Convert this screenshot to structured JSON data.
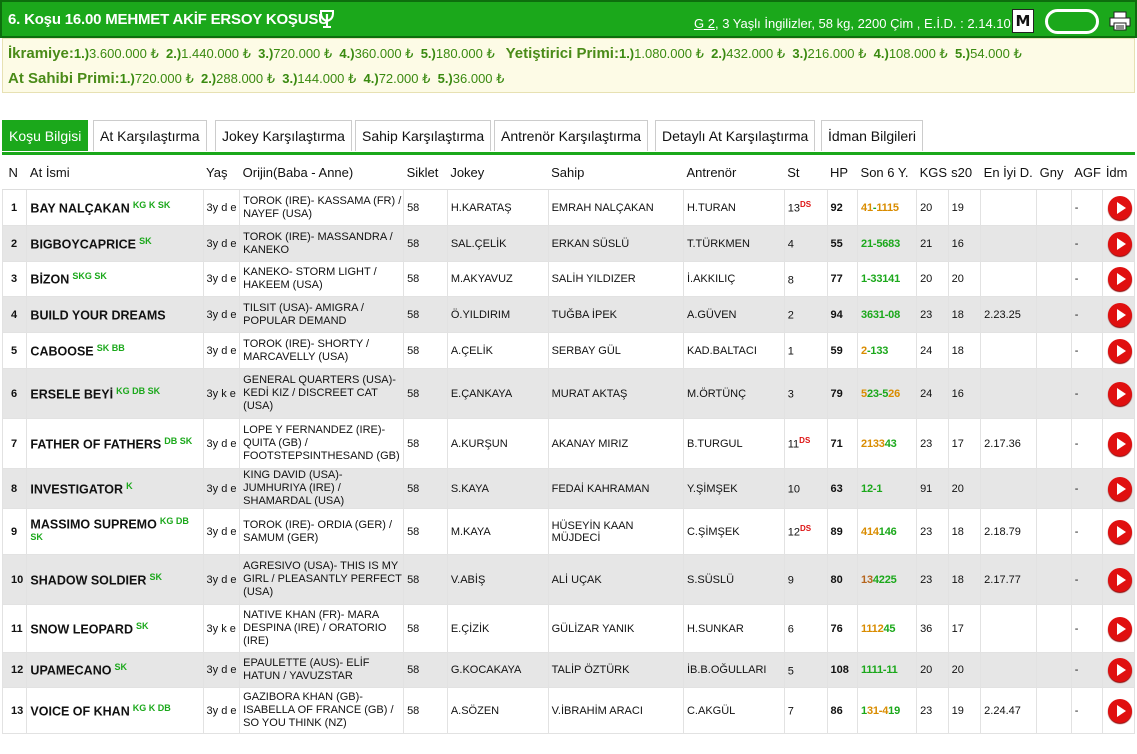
{
  "header": {
    "title": "6. Koşu 16.00 MEHMET AKİF ERSOY KOŞUSU",
    "group": "G 2",
    "info_rest": ", 3 Yaşlı İngilizler, 58 kg, 2200 Çim , E.İ.D. : 2.14.10",
    "m_label": "M"
  },
  "prize": {
    "ikramiye_label": "İkramiye:",
    "ikramiye": [
      {
        "pos": "1.)",
        "amt": "3.600.000 ₺"
      },
      {
        "pos": "2.)",
        "amt": "1.440.000 ₺"
      },
      {
        "pos": "3.)",
        "amt": "720.000 ₺"
      },
      {
        "pos": "4.)",
        "amt": "360.000 ₺"
      },
      {
        "pos": "5.)",
        "amt": "180.000 ₺"
      }
    ],
    "yetistirici_label": "Yetiştirici Primi:",
    "yetistirici": [
      {
        "pos": "1.)",
        "amt": "1.080.000 ₺"
      },
      {
        "pos": "2.)",
        "amt": "432.000 ₺"
      },
      {
        "pos": "3.)",
        "amt": "216.000 ₺"
      },
      {
        "pos": "4.)",
        "amt": "108.000 ₺"
      },
      {
        "pos": "5.)",
        "amt": "54.000 ₺"
      }
    ],
    "atsahibi_label": "At Sahibi Primi:",
    "atsahibi": [
      {
        "pos": "1.)",
        "amt": "720.000 ₺"
      },
      {
        "pos": "2.)",
        "amt": "288.000 ₺"
      },
      {
        "pos": "3.)",
        "amt": "144.000 ₺"
      },
      {
        "pos": "4.)",
        "amt": "72.000 ₺"
      },
      {
        "pos": "5.)",
        "amt": "36.000 ₺"
      }
    ]
  },
  "tabs": [
    {
      "label": "Koşu Bilgisi",
      "active": true
    },
    {
      "label": "At Karşılaştırma"
    },
    {
      "label": "Jokey Karşılaştırma"
    },
    {
      "label": "Sahip Karşılaştırma"
    },
    {
      "label": "Antrenör Karşılaştırma"
    },
    {
      "label": "Detaylı At Karşılaştırma"
    },
    {
      "label": "İdman Bilgileri"
    }
  ],
  "columns": [
    "N",
    "At İsmi",
    "Yaş",
    "Orijin(Baba - Anne)",
    "Siklet",
    "Jokey",
    "Sahip",
    "Antrenör",
    "St",
    "HP",
    "Son 6 Y.",
    "KGS",
    "s20",
    "En İyi D.",
    "Gny",
    "AGF",
    "İdm"
  ],
  "colors": {
    "green": "#1ba81b",
    "orange": "#d98c00",
    "brown": "#b5651d",
    "red": "#d11111"
  },
  "rows": [
    {
      "n": "1",
      "name": "BAY NALÇAKAN",
      "badges": "KG K SK",
      "age": "3y d e",
      "origin": "TOROK (IRE)- KASSAMA (FR) / NAYEF (USA)",
      "weight": "58",
      "jockey": "H.KARATAŞ",
      "owner": "EMRAH NALÇAKAN",
      "trainer": "H.TURAN",
      "st": "13",
      "st_sup": "DS",
      "hp": "92",
      "last6": [
        [
          "41",
          "o"
        ],
        [
          "-",
          "g"
        ],
        [
          "1115",
          "o"
        ]
      ],
      "kgs": "20",
      "s20": "19",
      "best": "",
      "gny": "",
      "agf": "-"
    },
    {
      "n": "2",
      "name": "BIGBOYCAPRICE",
      "badges": "SK",
      "age": "3y d e",
      "origin": "TOROK (IRE)- MASSANDRA / KANEKO",
      "weight": "58",
      "jockey": "SAL.ÇELİK",
      "owner": "ERKAN SÜSLÜ",
      "trainer": "T.TÜRKMEN",
      "st": "4",
      "st_sup": "",
      "hp": "55",
      "last6": [
        [
          "21-5683",
          "g"
        ]
      ],
      "kgs": "21",
      "s20": "16",
      "best": "",
      "gny": "",
      "agf": "-"
    },
    {
      "n": "3",
      "name": "BİZON",
      "badges": "SKG SK",
      "age": "3y d e",
      "origin": "KANEKO- STORM LIGHT / HAKEEM (USA)",
      "weight": "58",
      "jockey": "M.AKYAVUZ",
      "owner": "SALİH YILDIZER",
      "trainer": "İ.AKKILIÇ",
      "st": "8",
      "st_sup": "",
      "hp": "77",
      "last6": [
        [
          "1-33141",
          "g"
        ]
      ],
      "kgs": "20",
      "s20": "20",
      "best": "",
      "gny": "",
      "agf": "-"
    },
    {
      "n": "4",
      "name": "BUILD YOUR DREAMS",
      "badges": "",
      "age": "3y d e",
      "origin": "TILSIT (USA)- AMIGRA / POPULAR DEMAND",
      "weight": "58",
      "jockey": "Ö.YILDIRIM",
      "owner": "TUĞBA İPEK",
      "trainer": "A.GÜVEN",
      "st": "2",
      "st_sup": "",
      "hp": "94",
      "last6": [
        [
          "3631-08",
          "g"
        ]
      ],
      "kgs": "23",
      "s20": "18",
      "best": "2.23.25",
      "gny": "",
      "agf": "-"
    },
    {
      "n": "5",
      "name": "CABOOSE",
      "badges": "SK BB",
      "age": "3y d e",
      "origin": "TOROK (IRE)- SHORTY / MARCAVELLY (USA)",
      "weight": "58",
      "jockey": "A.ÇELİK",
      "owner": "SERBAY GÜL",
      "trainer": "KAD.BALTACI",
      "st": "1",
      "st_sup": "",
      "hp": "59",
      "last6": [
        [
          "2",
          "o"
        ],
        [
          "-133",
          "g"
        ]
      ],
      "kgs": "24",
      "s20": "18",
      "best": "",
      "gny": "",
      "agf": "-"
    },
    {
      "n": "6",
      "name": "ERSELE BEYİ",
      "badges": "KG DB SK",
      "age": "3y k e",
      "origin": "GENERAL QUARTERS (USA)- KEDİ KIZ / DISCREET CAT (USA)",
      "weight": "58",
      "jockey": "E.ÇANKAYA",
      "owner": "MURAT AKTAŞ",
      "trainer": "M.ÖRTÜNÇ",
      "st": "3",
      "st_sup": "",
      "hp": "79",
      "last6": [
        [
          "5",
          "o"
        ],
        [
          "23-5",
          "g"
        ],
        [
          "26",
          "o"
        ]
      ],
      "kgs": "24",
      "s20": "16",
      "best": "",
      "gny": "",
      "agf": "-"
    },
    {
      "n": "7",
      "name": "FATHER OF FATHERS",
      "badges": "DB SK",
      "age": "3y d e",
      "origin": "LOPE Y FERNANDEZ (IRE)- QUITA (GB) / FOOTSTEPSINTHESAND (GB)",
      "weight": "58",
      "jockey": "A.KURŞUN",
      "owner": "AKANAY MIRIZ",
      "trainer": "B.TURGUL",
      "st": "11",
      "st_sup": "DS",
      "hp": "71",
      "last6": [
        [
          "2133",
          "o"
        ],
        [
          "43",
          "g"
        ]
      ],
      "kgs": "23",
      "s20": "17",
      "best": "2.17.36",
      "gny": "",
      "agf": "-"
    },
    {
      "n": "8",
      "name": "INVESTIGATOR",
      "badges": "K",
      "age": "3y d e",
      "origin": "KING DAVID (USA)- JUMHURIYA (IRE) / SHAMARDAL (USA)",
      "weight": "58",
      "jockey": "S.KAYA",
      "owner": "FEDAİ KAHRAMAN",
      "trainer": "Y.ŞİMŞEK",
      "st": "10",
      "st_sup": "",
      "hp": "63",
      "last6": [
        [
          "12-1",
          "g"
        ]
      ],
      "kgs": "91",
      "s20": "20",
      "best": "",
      "gny": "",
      "agf": "-"
    },
    {
      "n": "9",
      "name": "MASSIMO SUPREMO",
      "badges": "KG DB SK",
      "age": "3y d e",
      "origin": "TOROK (IRE)- ORDIA (GER) / SAMUM (GER)",
      "weight": "58",
      "jockey": "M.KAYA",
      "owner": "HÜSEYİN KAAN MÜJDECİ",
      "trainer": "C.ŞİMŞEK",
      "st": "12",
      "st_sup": "DS",
      "hp": "89",
      "last6": [
        [
          "414",
          "o"
        ],
        [
          "146",
          "g"
        ]
      ],
      "kgs": "23",
      "s20": "18",
      "best": "2.18.79",
      "gny": "",
      "agf": "-"
    },
    {
      "n": "10",
      "name": "SHADOW SOLDIER",
      "badges": "SK",
      "age": "3y d e",
      "origin": "AGRESIVO (USA)- THIS IS MY GIRL / PLEASANTLY PERFECT (USA)",
      "weight": "58",
      "jockey": "V.ABİŞ",
      "owner": "ALİ UÇAK",
      "trainer": "S.SÜSLÜ",
      "st": "9",
      "st_sup": "",
      "hp": "80",
      "last6": [
        [
          "13",
          "b"
        ],
        [
          "4225",
          "g"
        ]
      ],
      "kgs": "23",
      "s20": "18",
      "best": "2.17.77",
      "gny": "",
      "agf": "-"
    },
    {
      "n": "11",
      "name": "SNOW LEOPARD",
      "badges": "SK",
      "age": "3y k e",
      "origin": "NATIVE KHAN (FR)- MARA DESPINA (IRE) / ORATORIO (IRE)",
      "weight": "58",
      "jockey": "E.ÇİZİK",
      "owner": "GÜLİZAR YANIK",
      "trainer": "H.SUNKAR",
      "st": "6",
      "st_sup": "",
      "hp": "76",
      "last6": [
        [
          "1112",
          "o"
        ],
        [
          "45",
          "g"
        ]
      ],
      "kgs": "36",
      "s20": "17",
      "best": "",
      "gny": "",
      "agf": "-"
    },
    {
      "n": "12",
      "name": "UPAMECANO",
      "badges": "SK",
      "age": "3y d e",
      "origin": "EPAULETTE (AUS)- ELİF HATUN / YAVUZSTAR",
      "weight": "58",
      "jockey": "G.KOCAKAYA",
      "owner": "TALİP ÖZTÜRK",
      "trainer": "İB.B.OĞULLARI",
      "st": "5",
      "st_sup": "",
      "hp": "108",
      "last6": [
        [
          "1111-11",
          "g"
        ]
      ],
      "kgs": "20",
      "s20": "20",
      "best": "",
      "gny": "",
      "agf": "-"
    },
    {
      "n": "13",
      "name": "VOICE OF KHAN",
      "badges": "KG K DB",
      "age": "3y d e",
      "origin": "GAZIBORA KHAN (GB)- ISABELLA OF FRANCE (GB) / SO YOU THINK (NZ)",
      "weight": "58",
      "jockey": "A.SÖZEN",
      "owner": "V.İBRAHİM ARACI",
      "trainer": "C.AKGÜL",
      "st": "7",
      "st_sup": "",
      "hp": "86",
      "last6": [
        [
          "1",
          "g"
        ],
        [
          "31-4",
          "o"
        ],
        [
          "19",
          "g"
        ]
      ],
      "kgs": "23",
      "s20": "19",
      "best": "2.24.47",
      "gny": "",
      "agf": "-"
    }
  ]
}
